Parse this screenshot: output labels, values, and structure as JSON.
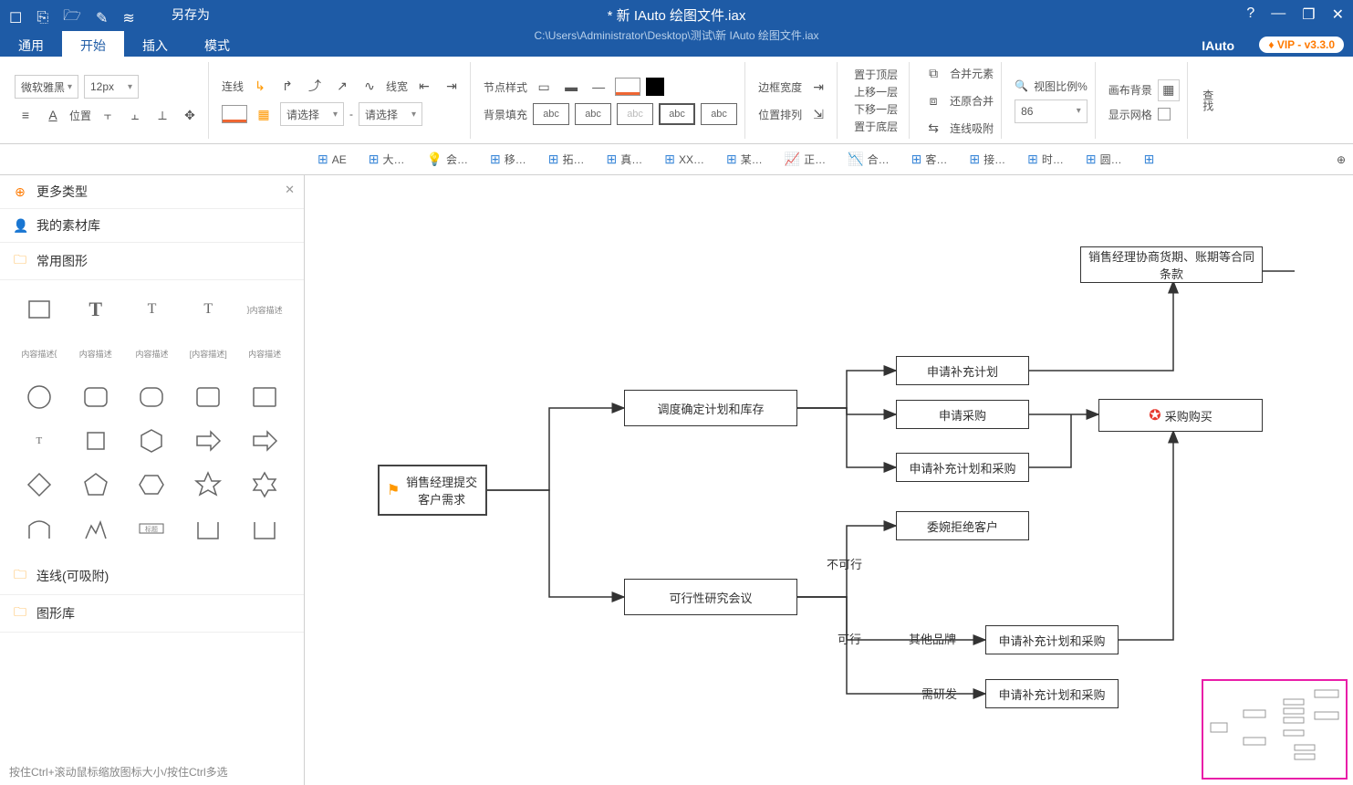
{
  "titlebar": {
    "saveas": "另存为",
    "title": "* 新 IAuto 绘图文件.iax",
    "path": "C:\\Users\\Administrator\\Desktop\\测试\\新 IAuto 绘图文件.iax",
    "brand": "IAuto",
    "vip": "♦ VIP - v3.3.0"
  },
  "menu": {
    "general": "通用",
    "start": "开始",
    "insert": "插入",
    "mode": "模式"
  },
  "ribbon": {
    "font": "微软雅黑",
    "size": "12px",
    "pos": "位置",
    "line": "连线",
    "width": "线宽",
    "nodestyle": "节点样式",
    "select1": "请选择",
    "select2": "请选择",
    "bgfill": "背景填充",
    "abc": "abc",
    "layout": "位置排列",
    "border": "边框宽度",
    "layer_top": "置于顶层",
    "layer_up": "上移一层",
    "layer_down": "下移一层",
    "layer_bottom": "置于底层",
    "merge": "合并元素",
    "unmerge": "还原合并",
    "snap": "连线吸附",
    "zoom_label": "视图比例%",
    "zoom_val": "86",
    "canvas_bg": "画布背景",
    "show_grid": "显示网格",
    "search": "查找"
  },
  "tabs": [
    "AE",
    "大…",
    "会…",
    "移…",
    "拓…",
    "真…",
    "XX…",
    "某…",
    "正…",
    "合…",
    "客…",
    "接…",
    "时…",
    "圆…"
  ],
  "sidebar": {
    "more": "更多类型",
    "mylib": "我的素材库",
    "common": "常用图形",
    "lines": "连线(可吸附)",
    "shapelib": "图形库",
    "foot": "按住Ctrl+滚动鼠标缩放图标大小/按住Ctrl多选",
    "desc": "内容描述"
  },
  "nodes": {
    "n1": "销售经理提交客户需求",
    "n2": "调度确定计划和库存",
    "n3": "可行性研究会议",
    "n4": "销售经理协商货期、账期等合同条款",
    "n5": "申请补充计划",
    "n6": "申请采购",
    "n7": "申请补充计划和采购",
    "n8": "委婉拒绝客户",
    "n9": "申请补充计划和采购",
    "n10": "申请补充计划和采购",
    "n11": "采购购买"
  },
  "edge_labels": {
    "not": "不可行",
    "yes": "可行",
    "other": "其他品牌",
    "rd": "需研发"
  }
}
